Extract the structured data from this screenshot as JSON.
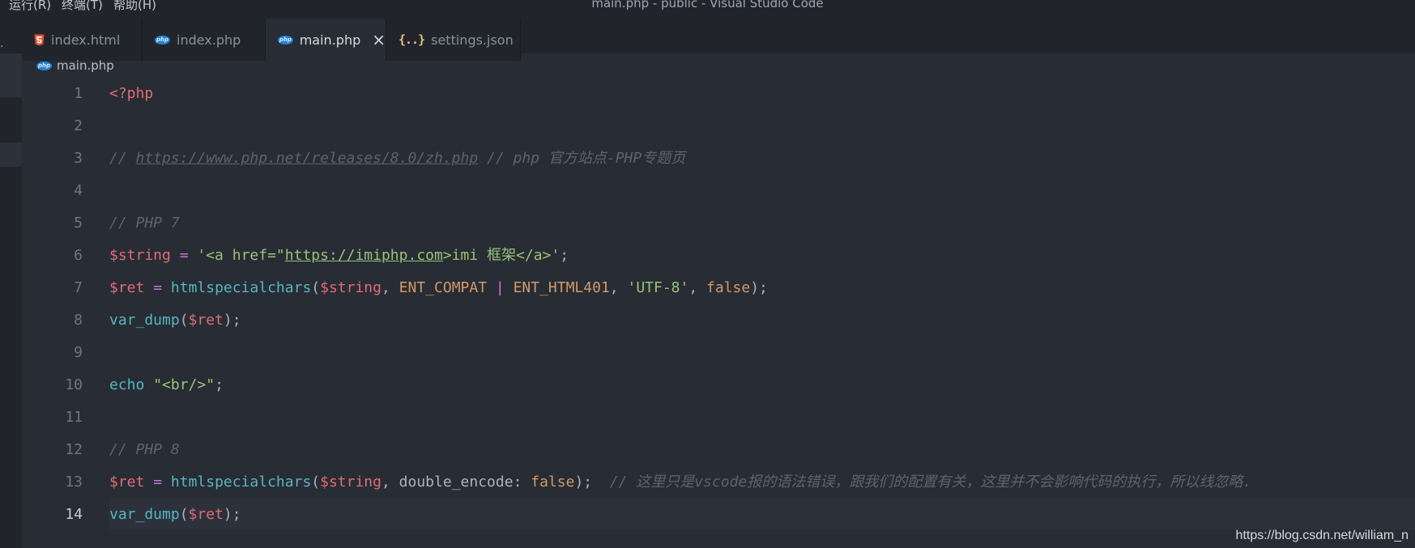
{
  "menu": {
    "items": [
      {
        "id": "run",
        "label": "运行(R)"
      },
      {
        "id": "terminal",
        "label": "终端(T)"
      },
      {
        "id": "help",
        "label": "帮助(H)"
      }
    ],
    "window_title": "main.php - public - Visual Studio Code"
  },
  "tabs": [
    {
      "label": "index.html",
      "icon": "html5-icon",
      "active": false
    },
    {
      "label": "index.php",
      "icon": "php-icon",
      "active": false
    },
    {
      "label": "main.php",
      "icon": "php-icon",
      "active": true,
      "close": "×"
    },
    {
      "label": "settings.json",
      "icon": "json-braces-icon",
      "active": false
    }
  ],
  "php_icon_text": "php",
  "json_icon_text": "{..}",
  "breadcrumb": {
    "file": "main.php",
    "icon": "php-icon"
  },
  "editor": {
    "active_line": 14,
    "lines": [
      {
        "n": "1",
        "tokens": [
          {
            "t": "<?php",
            "c": "tag"
          }
        ]
      },
      {
        "n": "2",
        "tokens": []
      },
      {
        "n": "3",
        "tokens": [
          {
            "t": "// ",
            "c": "comment"
          },
          {
            "t": "https://www.php.net/releases/8.0/zh.php",
            "c": "comment link"
          },
          {
            "t": " // php 官方站点-PHP专题页",
            "c": "comment"
          }
        ]
      },
      {
        "n": "4",
        "tokens": []
      },
      {
        "n": "5",
        "tokens": [
          {
            "t": "// PHP 7",
            "c": "comment"
          }
        ]
      },
      {
        "n": "6",
        "tokens": [
          {
            "t": "$string",
            "c": "var"
          },
          {
            "t": " ",
            "c": "punc"
          },
          {
            "t": "=",
            "c": "op"
          },
          {
            "t": " '<a href=\"",
            "c": "str"
          },
          {
            "t": "https://imiphp.com",
            "c": "strlink"
          },
          {
            "t": ">imi 框架</a>'",
            "c": "str"
          },
          {
            "t": ";",
            "c": "punc"
          }
        ]
      },
      {
        "n": "7",
        "tokens": [
          {
            "t": "$ret",
            "c": "var"
          },
          {
            "t": " ",
            "c": "punc"
          },
          {
            "t": "=",
            "c": "op"
          },
          {
            "t": " ",
            "c": "punc"
          },
          {
            "t": "htmlspecialchars",
            "c": "func"
          },
          {
            "t": "(",
            "c": "punc"
          },
          {
            "t": "$string",
            "c": "var"
          },
          {
            "t": ", ",
            "c": "punc"
          },
          {
            "t": "ENT_COMPAT",
            "c": "const"
          },
          {
            "t": " ",
            "c": "punc"
          },
          {
            "t": "|",
            "c": "op"
          },
          {
            "t": " ",
            "c": "punc"
          },
          {
            "t": "ENT_HTML401",
            "c": "const"
          },
          {
            "t": ", ",
            "c": "punc"
          },
          {
            "t": "'UTF-8'",
            "c": "str"
          },
          {
            "t": ", ",
            "c": "punc"
          },
          {
            "t": "false",
            "c": "const"
          },
          {
            "t": ");",
            "c": "punc"
          }
        ]
      },
      {
        "n": "8",
        "tokens": [
          {
            "t": "var_dump",
            "c": "func"
          },
          {
            "t": "(",
            "c": "punc"
          },
          {
            "t": "$ret",
            "c": "var"
          },
          {
            "t": ");",
            "c": "punc"
          }
        ]
      },
      {
        "n": "9",
        "tokens": []
      },
      {
        "n": "10",
        "tokens": [
          {
            "t": "echo",
            "c": "func"
          },
          {
            "t": " ",
            "c": "punc"
          },
          {
            "t": "\"<br/>\"",
            "c": "str"
          },
          {
            "t": ";",
            "c": "punc"
          }
        ]
      },
      {
        "n": "11",
        "tokens": []
      },
      {
        "n": "12",
        "tokens": [
          {
            "t": "// PHP 8",
            "c": "comment"
          }
        ]
      },
      {
        "n": "13",
        "tokens": [
          {
            "t": "$ret",
            "c": "var"
          },
          {
            "t": " ",
            "c": "punc"
          },
          {
            "t": "=",
            "c": "op"
          },
          {
            "t": " ",
            "c": "punc"
          },
          {
            "t": "htmlspecialchars",
            "c": "func"
          },
          {
            "t": "(",
            "c": "punc"
          },
          {
            "t": "$string",
            "c": "var"
          },
          {
            "t": ", ",
            "c": "punc"
          },
          {
            "t": "double_encode",
            "c": "param"
          },
          {
            "t": ": ",
            "c": "punc"
          },
          {
            "t": "false",
            "c": "const"
          },
          {
            "t": ");",
            "c": "punc"
          },
          {
            "t": "  // 这里只是vscode报的语法错误，跟我们的配置有关，这里并不会影响代码的执行，所以线忽略.",
            "c": "comment"
          }
        ]
      },
      {
        "n": "14",
        "tokens": [
          {
            "t": "var_dump",
            "c": "func"
          },
          {
            "t": "(",
            "c": "punc"
          },
          {
            "t": "$ret",
            "c": "var"
          },
          {
            "t": ");",
            "c": "punc"
          }
        ]
      }
    ]
  },
  "watermark": "https://blog.csdn.net/william_n",
  "colors": {
    "editor_bg": "#282c34",
    "tabbar_bg": "#21252b",
    "comment": "#5c6370",
    "variable": "#e06c75",
    "function": "#56b6c2",
    "string": "#98c379",
    "constant": "#d19a66",
    "operator": "#c678dd",
    "php_badge": "#1f84d6",
    "html5_badge": "#e44d26",
    "json_badge": "#e5c07b"
  }
}
